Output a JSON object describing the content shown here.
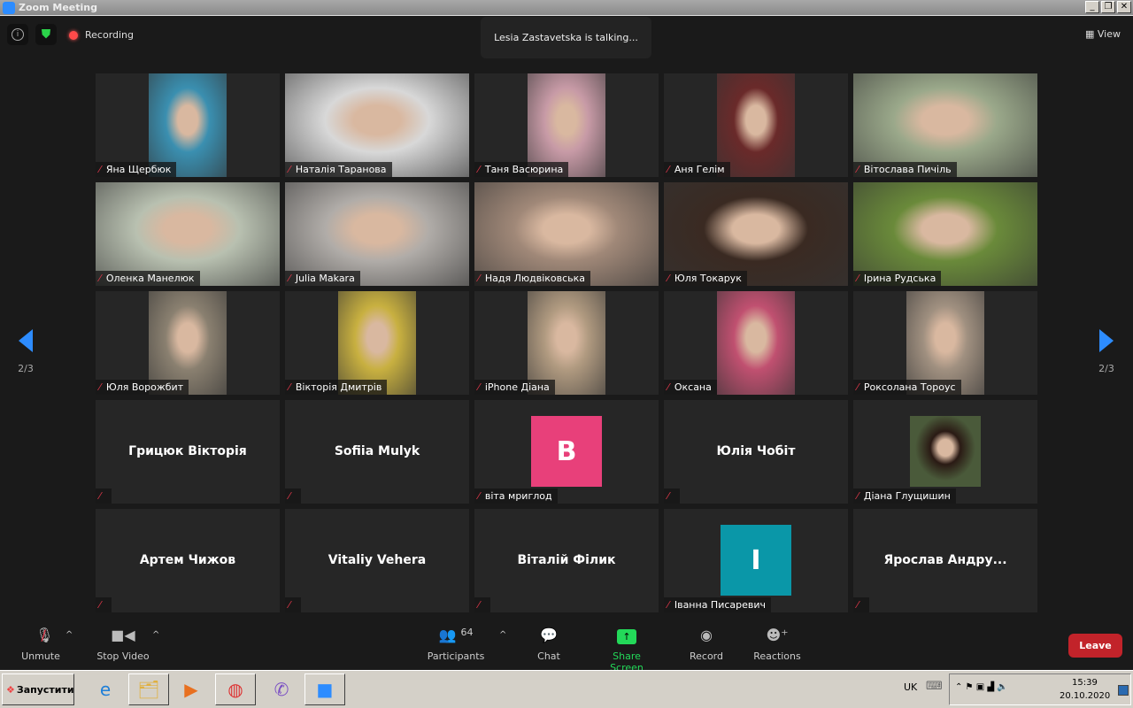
{
  "window": {
    "title": "Zoom Meeting",
    "minimize": "_",
    "restore": "❐",
    "close": "✕"
  },
  "topbar": {
    "recording": "Recording",
    "talking": "Lesia Zastavetska is talking...",
    "view": "View"
  },
  "pager": {
    "left": "2/3",
    "right": "2/3"
  },
  "tiles": [
    {
      "name": "Яна Щербюк",
      "type": "video",
      "narrow": true,
      "color": "#3a8fb0"
    },
    {
      "name": "Наталія  Таранова",
      "type": "video",
      "narrow": false,
      "color": "#d8d8d8"
    },
    {
      "name": "Таня Васюрина",
      "type": "video",
      "narrow": true,
      "color": "#c79aa6"
    },
    {
      "name": "Аня Гелім",
      "type": "video",
      "narrow": true,
      "color": "#6a2a2a"
    },
    {
      "name": "Вітослава Пичіль",
      "type": "video",
      "narrow": false,
      "color": "#9aa88a"
    },
    {
      "name": "Оленка Манелюк",
      "type": "video",
      "narrow": false,
      "color": "#b8c0b0"
    },
    {
      "name": "Julia Makara",
      "type": "video",
      "narrow": false,
      "color": "#b0aca8"
    },
    {
      "name": "Надя Людвіковська",
      "type": "video",
      "narrow": false,
      "color": "#a08878"
    },
    {
      "name": "Юля Токарук",
      "type": "video",
      "narrow": false,
      "color": "#3a2a22"
    },
    {
      "name": "Ірина Рудська",
      "type": "video",
      "narrow": false,
      "color": "#6a8a3a"
    },
    {
      "name": "Юля Ворожбит",
      "type": "video",
      "narrow": true,
      "color": "#8a8070"
    },
    {
      "name": "Вікторія Дмитрів",
      "type": "video",
      "narrow": true,
      "color": "#c8b040"
    },
    {
      "name": "iPhone Діана",
      "type": "video",
      "narrow": true,
      "color": "#b09a80"
    },
    {
      "name": "Оксана",
      "type": "video",
      "narrow": true,
      "color": "#c05070"
    },
    {
      "name": "Роксолана Тороус",
      "type": "video",
      "narrow": true,
      "color": "#a09080"
    },
    {
      "name": "",
      "big": "Грицюк Вікторія",
      "type": "name"
    },
    {
      "name": "",
      "big": "Sofiia Mulyk",
      "type": "name"
    },
    {
      "name": "віта мриглод",
      "type": "avatar",
      "letter": "B",
      "color": "#e8407a"
    },
    {
      "name": "",
      "big": "Юлія Чобіт",
      "type": "name"
    },
    {
      "name": "Діана Глущишин",
      "type": "photo",
      "color": "#4a5a3a"
    },
    {
      "name": "",
      "big": "Артем Чижов",
      "type": "name"
    },
    {
      "name": "",
      "big": "Vitaliy Vehera",
      "type": "name"
    },
    {
      "name": "",
      "big": "Віталій Філик",
      "type": "name"
    },
    {
      "name": "Іванна Писаревич",
      "type": "avatar",
      "letter": "I",
      "color": "#0a97a8"
    },
    {
      "name": "",
      "big": "Ярослав  Андру...",
      "type": "name"
    }
  ],
  "toolbar": {
    "unmute": "Unmute",
    "stop_video": "Stop Video",
    "participants": "Participants",
    "participants_count": "64",
    "chat": "Chat",
    "share_screen": "Share Screen",
    "record": "Record",
    "reactions": "Reactions",
    "leave": "Leave"
  },
  "taskbar": {
    "start": "Запустити",
    "lang": "UK",
    "time": "15:39",
    "date": "20.10.2020"
  },
  "colors": {
    "accent": "#2d8cff",
    "share": "#23d959",
    "leave": "#c2232a",
    "arrow": "#2d8cff"
  }
}
